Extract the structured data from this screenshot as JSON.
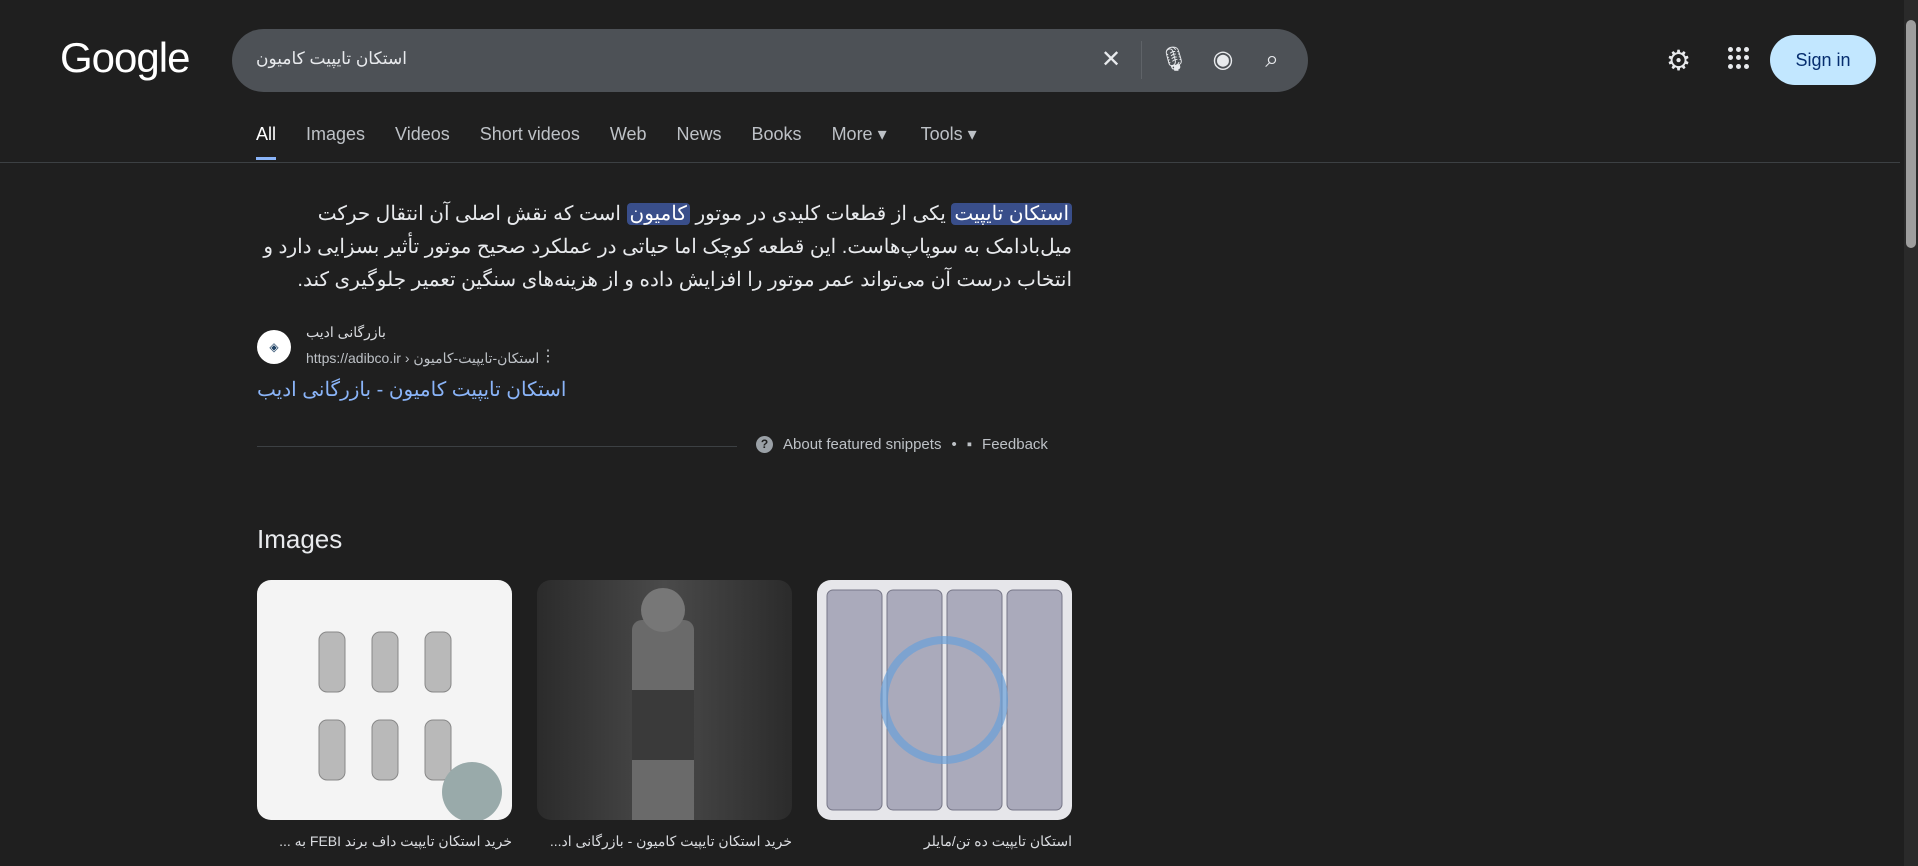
{
  "header": {
    "logo": "Google",
    "query": "استکان تایپیت کامیون",
    "sign_in": "Sign in"
  },
  "tabs": [
    "All",
    "Images",
    "Videos",
    "Short videos",
    "Web",
    "News",
    "Books",
    "More ▾",
    "Tools ▾"
  ],
  "snippet": {
    "hl1": "استکان تایپیت",
    "t1": " یکی از قطعات کلیدی در موتور ",
    "hl2": "کامیون",
    "t2": " است که نقش اصلی آن انتقال حرکت میل‌بادامک به سوپاپ‌هاست. این قطعه کوچک اما حیاتی در عملکرد صحیح موتور تأثیر بسزایی دارد و انتخاب درست آن می‌تواند عمر موتور را افزایش داده و از هزینه‌های سنگین تعمیر جلوگیری کند.",
    "source_name": "بازرگانی ادیب",
    "source_url": "https://adibco.ir › استکان-تایپیت-کامیون",
    "title": "استکان تایپیت کامیون - بازرگانی ادیب",
    "about": "About featured snippets",
    "feedback": "Feedback"
  },
  "images": {
    "heading": "Images",
    "items": [
      {
        "caption": "خرید استکان تایپیت داف برند FEBI به ..."
      },
      {
        "caption": "خرید استکان تایپیت کامیون - بازرگانی اد..."
      },
      {
        "caption": "استکان تایپیت ده تن/مایلر"
      }
    ]
  }
}
